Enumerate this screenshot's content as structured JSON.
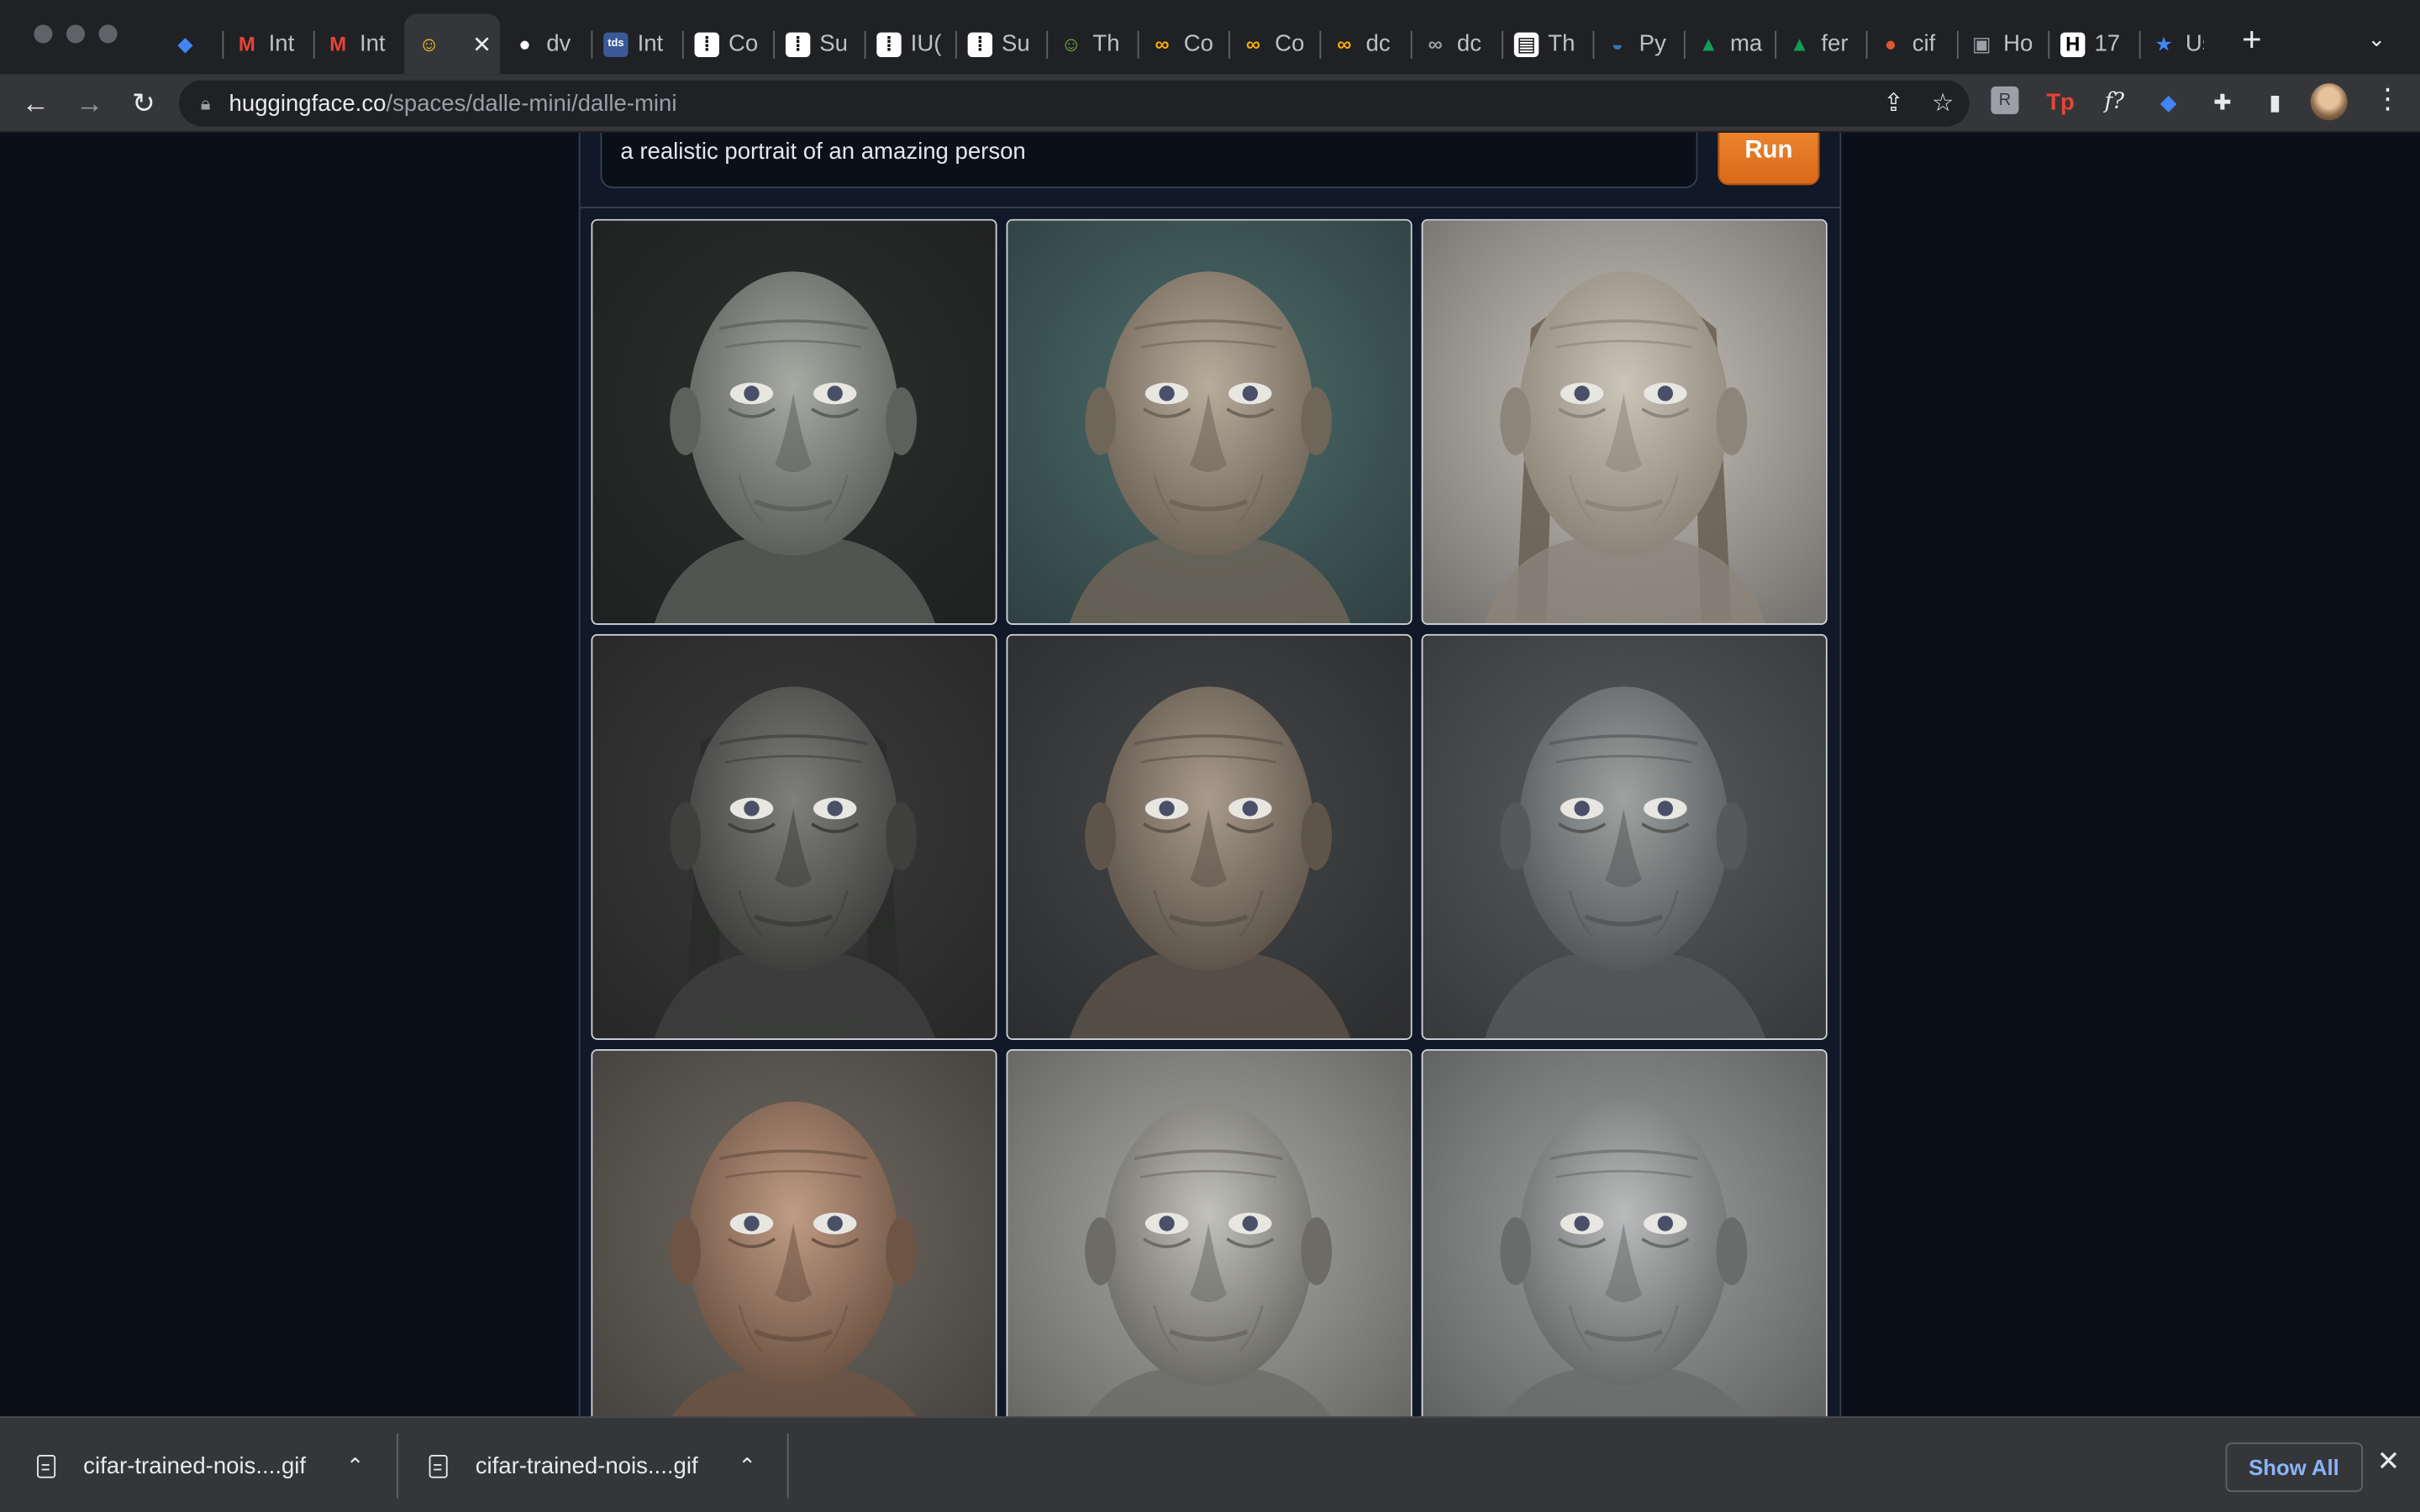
{
  "tabs": [
    {
      "label": "",
      "icon": "gem-icon",
      "color": "#4285f4"
    },
    {
      "label": "Int",
      "icon": "gmail-icon",
      "color": "#ea4335"
    },
    {
      "label": "Int",
      "icon": "gmail-icon",
      "color": "#ea4335"
    },
    {
      "label": "",
      "icon": "huggingface-icon",
      "color": "#ffd21e",
      "active": true
    },
    {
      "label": "dv",
      "icon": "github-icon",
      "color": "#ffffff"
    },
    {
      "label": "Int",
      "icon": "tds-icon",
      "color": "#3b5998"
    },
    {
      "label": "Co",
      "icon": "medium-icon",
      "color": "#000000"
    },
    {
      "label": "Su",
      "icon": "medium-icon",
      "color": "#000000"
    },
    {
      "label": "IU(",
      "icon": "medium-icon",
      "color": "#000000"
    },
    {
      "label": "Su",
      "icon": "medium-icon",
      "color": "#000000"
    },
    {
      "label": "Th",
      "icon": "smile-icon",
      "color": "#7cb342"
    },
    {
      "label": "Co",
      "icon": "colab-icon",
      "color": "#f9ab00"
    },
    {
      "label": "Co",
      "icon": "colab-icon",
      "color": "#f9ab00"
    },
    {
      "label": "dc",
      "icon": "colab-icon",
      "color": "#f9ab00"
    },
    {
      "label": "dc",
      "icon": "colab-icon",
      "color": "#9aa0a6"
    },
    {
      "label": "Th",
      "icon": "doc-icon",
      "color": "#ffffff"
    },
    {
      "label": "Py",
      "icon": "python-icon",
      "color": "#3776ab"
    },
    {
      "label": "ma",
      "icon": "drive-icon",
      "color": "#0f9d58"
    },
    {
      "label": "fer",
      "icon": "drive-icon",
      "color": "#0f9d58"
    },
    {
      "label": "cif",
      "icon": "duckduckgo-icon",
      "color": "#de5833"
    },
    {
      "label": "Ho",
      "icon": "page-icon",
      "color": "#9aa0a6"
    },
    {
      "label": "17",
      "icon": "hp-icon",
      "color": "#0f9d58"
    },
    {
      "label": "Us",
      "icon": "star-icon",
      "color": "#4285f4"
    }
  ],
  "toolbar": {
    "url_host": "huggingface.co",
    "url_path": "/spaces/dalle-mini/dalle-mini"
  },
  "app": {
    "prompt_value": "a realistic portrait of an amazing person",
    "run_label": "Run",
    "accent_color": "#e97a22"
  },
  "downloads": {
    "items": [
      {
        "name": "cifar-trained-nois....gif"
      },
      {
        "name": "cifar-trained-nois....gif"
      }
    ],
    "show_all_label": "Show All"
  }
}
